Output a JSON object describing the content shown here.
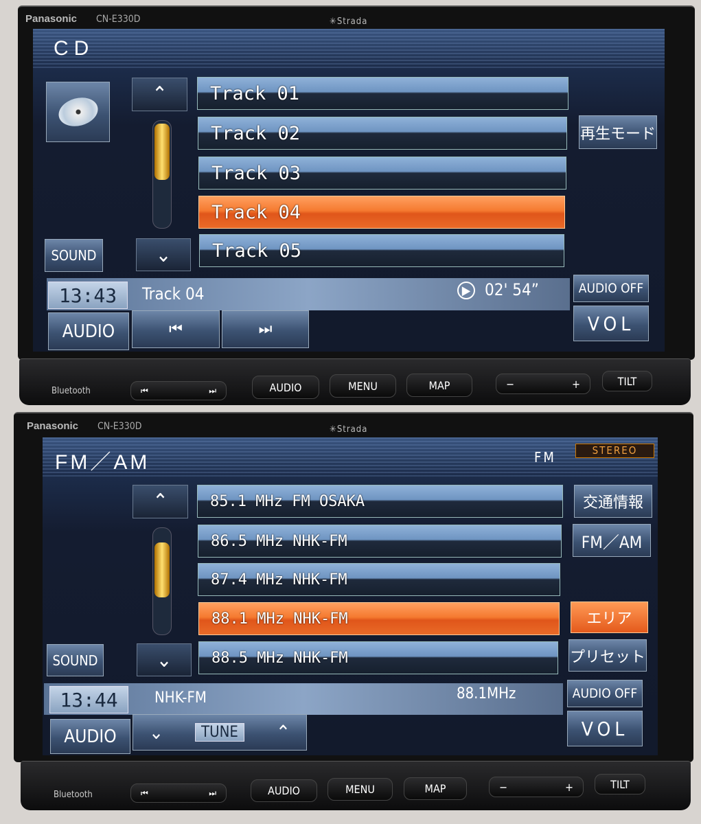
{
  "device": {
    "brand": "Panasonic",
    "model": "CN-E330D",
    "series": "Strada"
  },
  "hardware_buttons": {
    "bluetooth": "Bluetooth",
    "prev": "⏮",
    "next": "⏭",
    "audio": "AUDIO",
    "menu": "MENU",
    "map": "MAP",
    "minus": "−",
    "plus": "+",
    "tilt": "TILT"
  },
  "cd_screen": {
    "title": "CD",
    "tracks": [
      "Track 01",
      "Track 02",
      "Track 03",
      "Track 04",
      "Track 05"
    ],
    "selected_index": 3,
    "play_mode_button": "再生モード",
    "sound_button": "SOUND",
    "clock": "13:43",
    "now_playing": "Track 04",
    "play_icon": "▶",
    "elapsed": "02' 54”",
    "audio_off_button": "AUDIO OFF",
    "vol_button": "VOL",
    "audio_button": "AUDIO",
    "prev_button": "⏮",
    "next_button": "⏭",
    "scroll_up": "⌃",
    "scroll_down": "⌄"
  },
  "radio_screen": {
    "title": "FM／AM",
    "band": "FM",
    "stereo_badge": "STEREO",
    "stations": [
      "85.1 MHz FM OSAKA",
      "86.5 MHz NHK-FM",
      "87.4 MHz NHK-FM",
      "88.1 MHz NHK-FM",
      "88.5 MHz NHK-FM"
    ],
    "selected_index": 3,
    "side_buttons": [
      "交通情報",
      "FM／AM",
      "エリア",
      "プリセット"
    ],
    "sound_button": "SOUND",
    "clock": "13:44",
    "station_name": "NHK-FM",
    "frequency": "88.1MHz",
    "audio_off_button": "AUDIO OFF",
    "vol_button": "VOL",
    "audio_button": "AUDIO",
    "tune_label": "TUNE",
    "tune_down": "⌄",
    "tune_up": "⌃",
    "scroll_up": "⌃",
    "scroll_down": "⌄"
  },
  "colors": {
    "selected": "#f0702a",
    "list": "#7fa3cf",
    "stereo": "#f0a040"
  }
}
